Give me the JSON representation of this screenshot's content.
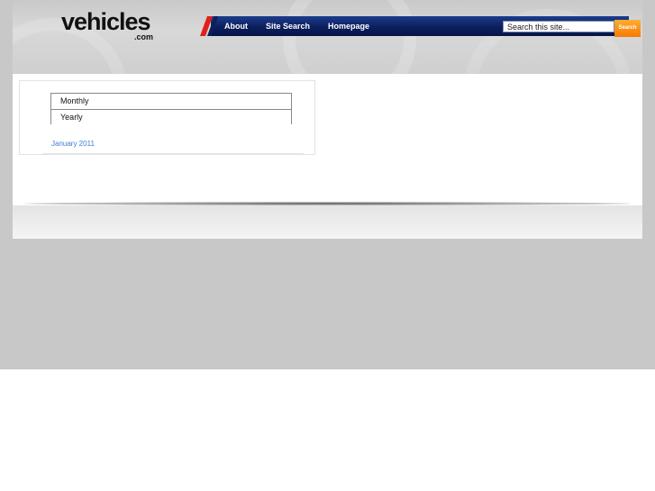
{
  "logo": {
    "main": "vehicles",
    "sub": ".com"
  },
  "nav": {
    "items": [
      {
        "label": "About"
      },
      {
        "label": "Site Search"
      },
      {
        "label": "Homepage"
      }
    ]
  },
  "search": {
    "value": "Search this site...",
    "button_label": "Search"
  },
  "archive": {
    "options": [
      {
        "label": "Monthly"
      },
      {
        "label": "Yearly"
      }
    ],
    "months": [
      {
        "label": "January 2011"
      }
    ]
  },
  "colors": {
    "nav_blue": "#0b1f5e",
    "accent_red": "#e0201b",
    "search_orange": "#f57a00",
    "link_blue": "#3b7fd1",
    "page_gray": "#c8c8c8"
  }
}
